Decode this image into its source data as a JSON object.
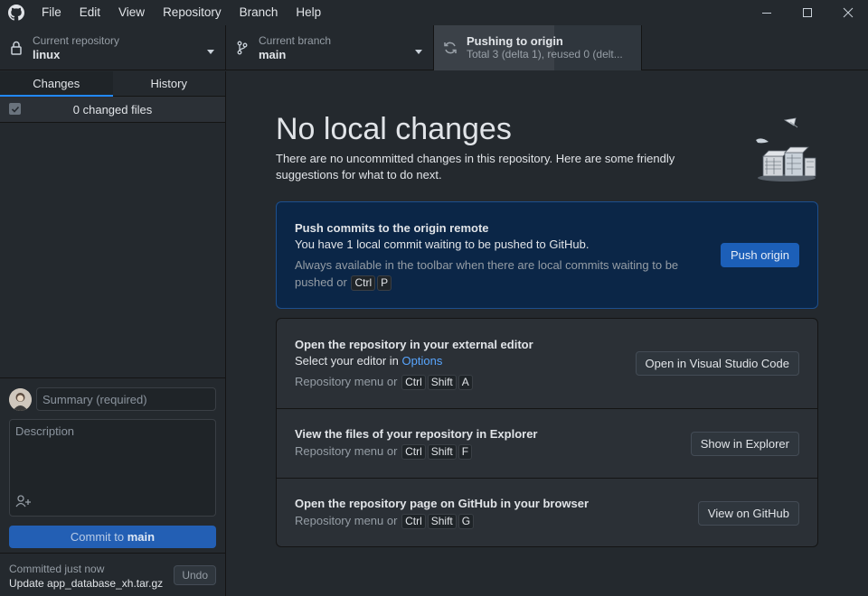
{
  "menu": [
    "File",
    "Edit",
    "View",
    "Repository",
    "Branch",
    "Help"
  ],
  "toolbar": {
    "repo_label": "Current repository",
    "repo_value": "linux",
    "branch_label": "Current branch",
    "branch_value": "main",
    "push_title": "Pushing to origin",
    "push_status": "Total 3 (delta 1), reused 0 (delt..."
  },
  "sidebar": {
    "tabs": [
      "Changes",
      "History"
    ],
    "changes_count": "0 changed files",
    "summary_placeholder": "Summary (required)",
    "description_placeholder": "Description",
    "commit_prefix": "Commit to",
    "commit_branch": "main",
    "last_commit_time": "Committed just now",
    "last_commit_message": "Update app_database_xh.tar.gz",
    "undo_label": "Undo"
  },
  "main": {
    "title": "No local changes",
    "subtitle": "There are no uncommitted changes in this repository. Here are some friendly suggestions for what to do next.",
    "push_card": {
      "title": "Push commits to the origin remote",
      "line": "You have 1 local commit waiting to be pushed to GitHub.",
      "hint": "Always available in the toolbar when there are local commits waiting to be pushed or",
      "keys": [
        "Ctrl",
        "P"
      ],
      "button": "Push origin"
    },
    "editor_card": {
      "title": "Open the repository in your external editor",
      "line_prefix": "Select your editor in",
      "line_link": "Options",
      "hint": "Repository menu or",
      "keys": [
        "Ctrl",
        "Shift",
        "A"
      ],
      "button": "Open in Visual Studio Code"
    },
    "explorer_card": {
      "title": "View the files of your repository in Explorer",
      "hint": "Repository menu or",
      "keys": [
        "Ctrl",
        "Shift",
        "F"
      ],
      "button": "Show in Explorer"
    },
    "github_card": {
      "title": "Open the repository page on GitHub in your browser",
      "hint": "Repository menu or",
      "keys": [
        "Ctrl",
        "Shift",
        "G"
      ],
      "button": "View on GitHub"
    }
  },
  "icons": {
    "app": "github-logo-icon",
    "repo": "lock-icon",
    "branch": "git-branch-icon",
    "push": "sync-icon",
    "coauthor": "person-add-icon"
  },
  "colors": {
    "background": "#24292e",
    "accent": "#2188ff",
    "primary_button": "#1f6feb",
    "push_card_bg": "#0b2647"
  }
}
